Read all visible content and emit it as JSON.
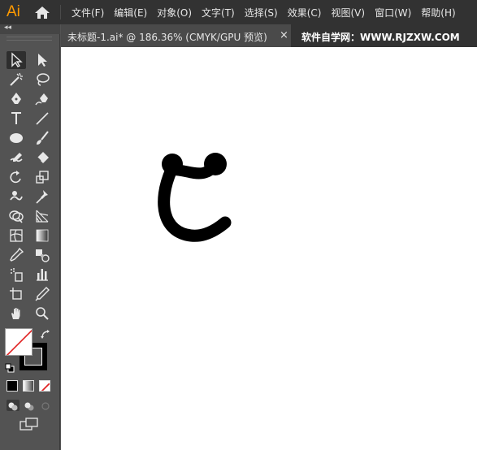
{
  "app": {
    "logo": "Ai"
  },
  "menu": {
    "items": [
      "文件(F)",
      "编辑(E)",
      "对象(O)",
      "文字(T)",
      "选择(S)",
      "效果(C)",
      "视图(V)",
      "窗口(W)",
      "帮助(H)"
    ]
  },
  "tabs": {
    "active_label": "未标题-1.ai* @ 186.36% (CMYK/GPU 预览)",
    "close_glyph": "×",
    "other_label": "软件自学网：WWW.RJZXW.COM"
  },
  "toolbar": {
    "collapse_glyph": "◂◂"
  },
  "colors": {
    "accent_logo": "#ff9a00",
    "chrome": "#323232",
    "panel": "#535353",
    "canvas": "#ffffff",
    "artwork": "#000000"
  }
}
